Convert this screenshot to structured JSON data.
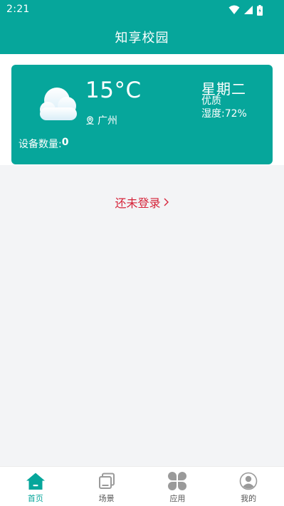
{
  "status_bar": {
    "time": "2:21"
  },
  "header": {
    "title": "知享校园"
  },
  "weather": {
    "temperature": "15°C",
    "city": "广州",
    "weekday": "星期二",
    "air_quality": "优质",
    "humidity": "湿度:72%",
    "device_label": "设备数量:",
    "device_count": "0",
    "icon": "cloud-icon"
  },
  "login": {
    "label": "还未登录",
    "arrow": "›"
  },
  "tabs": [
    {
      "label": "首页",
      "icon": "home-icon",
      "active": true
    },
    {
      "label": "场景",
      "icon": "scene-icon",
      "active": false
    },
    {
      "label": "应用",
      "icon": "apps-icon",
      "active": false
    },
    {
      "label": "我的",
      "icon": "profile-icon",
      "active": false
    }
  ],
  "colors": {
    "primary": "#06a69b",
    "login_text": "#d6243a",
    "background": "#f3f4f6"
  }
}
